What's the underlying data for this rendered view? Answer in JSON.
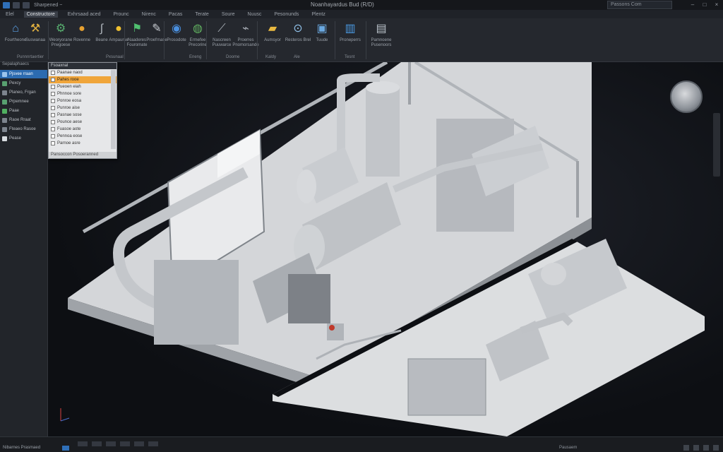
{
  "titlebar": {
    "quick_access_text": "Sharpened ~",
    "app_title": "Noanhayardus Bud (R/D)",
    "search_placeholder": "Passons Com"
  },
  "tabs": [
    "Elel",
    "Constructore",
    "Exhrsaad aced",
    "Prounc",
    "Nirenc",
    "Pacas",
    "Terate",
    "Soure",
    "Nuusc",
    "Pesonunds",
    "Plentz"
  ],
  "ribbon": {
    "buttons": [
      {
        "label": "Fourtheone",
        "icon": "building-icon"
      },
      {
        "label": "Suswanaa",
        "icon": "person-wrench-icon"
      },
      {
        "label": "Weoryorane Prwgoese",
        "icon": "earth-gear-icon"
      },
      {
        "label": "Rovenne",
        "icon": "molecule-icon"
      },
      {
        "label": "Beane",
        "icon": "hook-icon"
      },
      {
        "label": "Ampaurse",
        "icon": "bulb-icon"
      },
      {
        "label": "Naaderes Fouromate",
        "icon": "flag-icon"
      },
      {
        "label": "Proefrnase",
        "icon": "pencil-icon"
      },
      {
        "label": "Prosodote",
        "icon": "globe-icon"
      },
      {
        "label": "Ermefee Precorine",
        "icon": "globe-green-icon"
      },
      {
        "label": "Nascreen Puuwarce",
        "icon": "line-draw-icon"
      },
      {
        "label": "Proerres Pnomorsande",
        "icon": "pipe-icon"
      },
      {
        "label": "Aumsyor",
        "icon": "folder-icon"
      },
      {
        "label": "Resteros Brel",
        "icon": "magnifier-icon"
      },
      {
        "label": "Tuude",
        "icon": "screen-icon"
      },
      {
        "label": "Proneperrs",
        "icon": "chart-icon"
      },
      {
        "label": "Pamnoene Pusenoors",
        "icon": "clipboard-icon"
      }
    ],
    "groups": [
      "Punnnrtaertier",
      "Pxsunaal",
      "Eneng",
      "Doome",
      "Kaldy",
      "Ale",
      "Tesnt"
    ]
  },
  "browser": {
    "header": "Sepalaphaecs",
    "items": [
      "Pjsvee rraan",
      "Pexcy",
      "Planeo, Frgan",
      "Prpemnee",
      "Paae",
      "Raoe Rraat",
      "Fteaeo Rasoe",
      "Pease"
    ]
  },
  "dropdown": {
    "header": "Fsoaxnal",
    "rows": [
      "Paanae naod",
      "Pahes rooe",
      "Pueoen eiah",
      "Phnnoe sore",
      "Ponroe eosa",
      "Punroe aise",
      "Pasnae sose",
      "Pounce aese",
      "Fuasoe aote",
      "Pennoa eose",
      "Parnoe asre"
    ],
    "footer": "Pansoccon Posoeranned"
  },
  "statusbar": {
    "file_name": "Nibarnes Prasmaed",
    "right_text": "Pausaem"
  },
  "colors": {
    "accent": "#2c6bb0",
    "highlight": "#f0a53a",
    "model": "#c8cacd",
    "background": "#0d0f13"
  }
}
